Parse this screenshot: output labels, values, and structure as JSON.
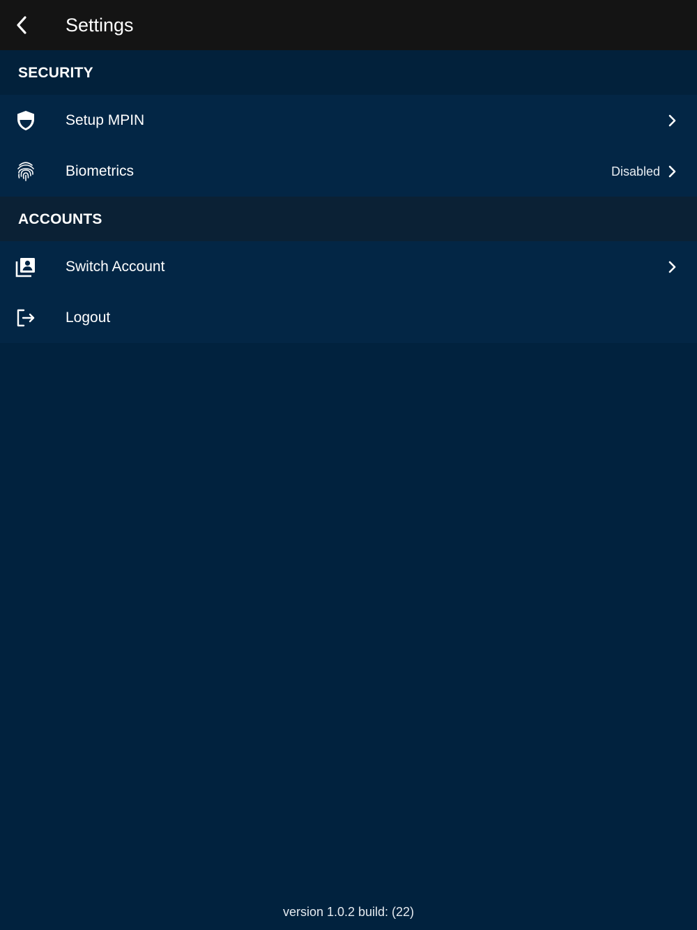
{
  "header": {
    "title": "Settings",
    "back_icon": "chevron-left-icon"
  },
  "sections": {
    "security": {
      "title": "SECURITY",
      "items": [
        {
          "label": "Setup MPIN",
          "icon": "shield-icon",
          "value": ""
        },
        {
          "label": "Biometrics",
          "icon": "fingerprint-icon",
          "value": "Disabled"
        }
      ]
    },
    "accounts": {
      "title": "ACCOUNTS",
      "items": [
        {
          "label": "Switch Account",
          "icon": "account-box-icon",
          "value": ""
        },
        {
          "label": "Logout",
          "icon": "logout-icon",
          "value": ""
        }
      ]
    }
  },
  "footer": {
    "version": "version 1.0.2 build: (22)"
  },
  "colors": {
    "topbar": "#141414",
    "background": "#01223e",
    "row": "#032645",
    "text": "#ffffff"
  }
}
